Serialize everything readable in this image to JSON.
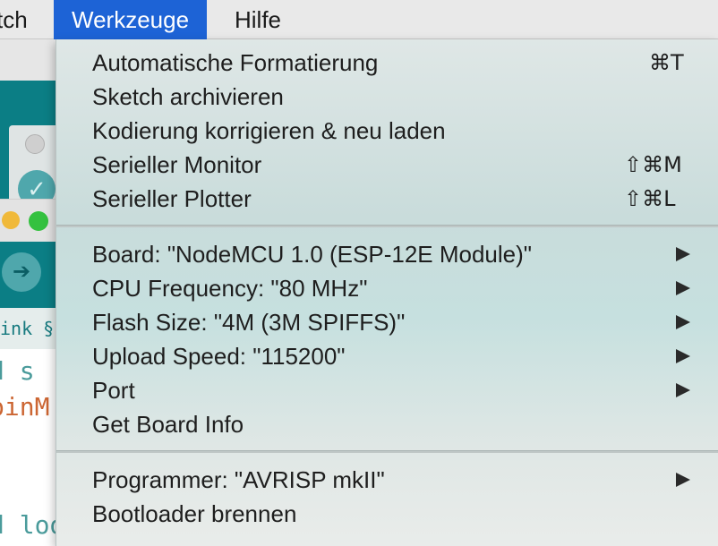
{
  "menubar": {
    "items": [
      {
        "label": "tch"
      },
      {
        "label": "Werkzeuge",
        "active": true
      },
      {
        "label": "Hilfe"
      }
    ]
  },
  "background_ide": {
    "tab_label": "ink §",
    "code_lines": [
      "d s",
      "pinM",
      "",
      "d loop() {"
    ]
  },
  "menu": {
    "groups": [
      [
        {
          "label": "Automatische Formatierung",
          "shortcut": "⌘T"
        },
        {
          "label": "Sketch archivieren"
        },
        {
          "label": "Kodierung korrigieren & neu laden"
        },
        {
          "label": "Serieller Monitor",
          "shortcut": "⇧⌘M"
        },
        {
          "label": "Serieller Plotter",
          "shortcut": "⇧⌘L"
        }
      ],
      [
        {
          "label": "Board: \"NodeMCU 1.0 (ESP-12E Module)\"",
          "submenu": true
        },
        {
          "label": "CPU Frequency: \"80 MHz\"",
          "submenu": true
        },
        {
          "label": "Flash Size: \"4M (3M SPIFFS)\"",
          "submenu": true
        },
        {
          "label": "Upload Speed: \"115200\"",
          "submenu": true
        },
        {
          "label": "Port",
          "submenu": true
        },
        {
          "label": "Get Board Info"
        }
      ],
      [
        {
          "label": "Programmer: \"AVRISP mkII\"",
          "submenu": true
        },
        {
          "label": "Bootloader brennen"
        }
      ]
    ]
  },
  "colors": {
    "menubar_bg": "#e9e9e9",
    "active_menu_bg": "#1d63d6",
    "arduino_teal": "#0b7e85"
  }
}
